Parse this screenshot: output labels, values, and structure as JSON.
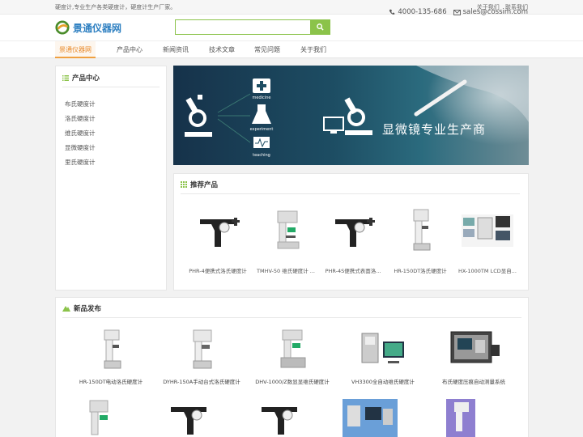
{
  "topbar": {
    "tagline": "硬度计,专业生产各类硬度计，硬度计生产厂家。",
    "links": [
      "关于我们",
      "联系我们"
    ]
  },
  "header": {
    "logo_text": "景通仪器网",
    "search_placeholder": "",
    "phone": "4000-135-686",
    "email": "sales@cossim.com"
  },
  "nav": {
    "items": [
      "景通仪器网",
      "产品中心",
      "新闻资讯",
      "技术文章",
      "常见问题",
      "关于我们"
    ],
    "active_index": 0
  },
  "sidebar": {
    "title": "产品中心",
    "items": [
      "布氏硬度计",
      "洛氏硬度计",
      "维氏硬度计",
      "显微硬度计",
      "里氏硬度计"
    ]
  },
  "banner": {
    "headline": "显微镜专业生产商",
    "labels": [
      "medicine",
      "experiment",
      "teaching"
    ]
  },
  "recommended": {
    "title": "推荐产品",
    "products": [
      {
        "name": "PHR-4便携式洛氏硬度计",
        "kind": "portable"
      },
      {
        "name": "TMHV-50 维氏硬度计 ...",
        "kind": "vickers"
      },
      {
        "name": "PHR-4S便携式表面洛...",
        "kind": "portable"
      },
      {
        "name": "HR-150DT洛氏硬度计",
        "kind": "rockwell"
      },
      {
        "name": "HX-1000TM LCD显自...",
        "kind": "system"
      }
    ]
  },
  "new_products": {
    "title": "新品发布",
    "row1": [
      {
        "name": "HR-150DT电动洛氏硬度计",
        "kind": "rockwell"
      },
      {
        "name": "DYHR-150A手动台式洛氏硬度计",
        "kind": "rockwell2"
      },
      {
        "name": "DHV-1000/Z数显显维氏硬度计",
        "kind": "vickers"
      },
      {
        "name": "VH3300全自动维氏硬度计",
        "kind": "auto"
      },
      {
        "name": "布氏硬度压痕自动测量系统",
        "kind": "case"
      }
    ],
    "row2": [
      {
        "kind": "vickers"
      },
      {
        "kind": "portable"
      },
      {
        "kind": "portable"
      },
      {
        "kind": "system"
      },
      {
        "kind": "vickers"
      }
    ]
  },
  "colors": {
    "accent_green": "#8bc34a",
    "nav_active": "#e98a2b",
    "logo_blue": "#2d7fc1"
  }
}
